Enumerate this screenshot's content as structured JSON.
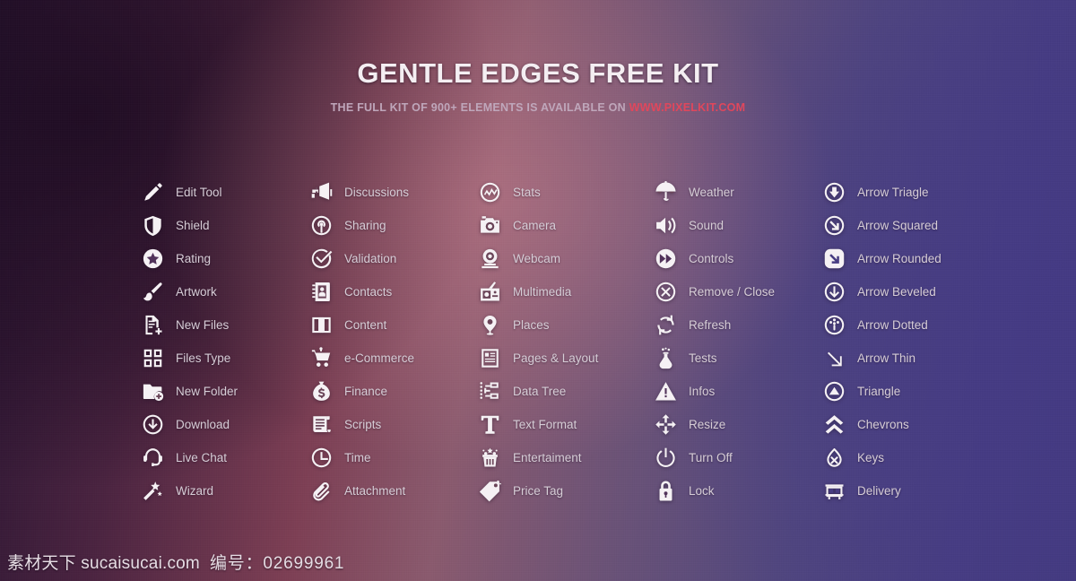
{
  "header": {
    "title": "GENTLE EDGES FREE KIT",
    "subtitle_prefix": "THE FULL KIT OF 900+ ELEMENTS IS AVAILABLE ON ",
    "subtitle_url": "WWW.PIXELKIT.COM"
  },
  "colors": {
    "title": "#f4eef2",
    "subtitle": "#bfa7bb",
    "url_accent": "#e0475c",
    "icon": "#f5f1f4",
    "label": "#d6cdd6",
    "bg_left": "#281431",
    "bg_mid": "#8a5a6e",
    "bg_right": "#473d82"
  },
  "columns": [
    {
      "name": "column-1",
      "items": [
        {
          "label": "Edit Tool",
          "icon": "pencil-icon"
        },
        {
          "label": "Shield",
          "icon": "shield-icon"
        },
        {
          "label": "Rating",
          "icon": "star-circle-icon"
        },
        {
          "label": "Artwork",
          "icon": "paintbrush-icon"
        },
        {
          "label": "New Files",
          "icon": "new-file-icon"
        },
        {
          "label": "Files Type",
          "icon": "grid-squares-icon"
        },
        {
          "label": "New Folder",
          "icon": "new-folder-icon"
        },
        {
          "label": "Download",
          "icon": "download-circle-icon"
        },
        {
          "label": "Live Chat",
          "icon": "headset-icon"
        },
        {
          "label": "Wizard",
          "icon": "magic-wand-icon"
        }
      ]
    },
    {
      "name": "column-2",
      "items": [
        {
          "label": "Discussions",
          "icon": "megaphone-icon"
        },
        {
          "label": "Sharing",
          "icon": "broadcast-circle-icon"
        },
        {
          "label": "Validation",
          "icon": "check-circle-icon"
        },
        {
          "label": "Contacts",
          "icon": "address-book-icon"
        },
        {
          "label": "Content",
          "icon": "open-book-icon"
        },
        {
          "label": "e-Commerce",
          "icon": "shopping-cart-icon"
        },
        {
          "label": "Finance",
          "icon": "money-bag-icon"
        },
        {
          "label": "Scripts",
          "icon": "scroll-document-icon"
        },
        {
          "label": "Time",
          "icon": "clock-icon"
        },
        {
          "label": "Attachment",
          "icon": "paperclip-icon"
        }
      ]
    },
    {
      "name": "column-3",
      "items": [
        {
          "label": "Stats",
          "icon": "stats-circle-icon"
        },
        {
          "label": "Camera",
          "icon": "camera-icon"
        },
        {
          "label": "Webcam",
          "icon": "webcam-icon"
        },
        {
          "label": "Multimedia",
          "icon": "radio-icon"
        },
        {
          "label": "Places",
          "icon": "map-pin-icon"
        },
        {
          "label": "Pages & Layout",
          "icon": "page-layout-icon"
        },
        {
          "label": "Data Tree",
          "icon": "data-tree-icon"
        },
        {
          "label": "Text Format",
          "icon": "text-format-icon"
        },
        {
          "label": "Entertaiment",
          "icon": "popcorn-icon"
        },
        {
          "label": "Price Tag",
          "icon": "price-tag-icon"
        }
      ]
    },
    {
      "name": "column-4",
      "items": [
        {
          "label": "Weather",
          "icon": "umbrella-icon"
        },
        {
          "label": "Sound",
          "icon": "speaker-icon"
        },
        {
          "label": "Controls",
          "icon": "fast-forward-circle-icon"
        },
        {
          "label": "Remove / Close",
          "icon": "close-circle-icon"
        },
        {
          "label": "Refresh",
          "icon": "refresh-icon"
        },
        {
          "label": "Tests",
          "icon": "flask-icon"
        },
        {
          "label": "Infos",
          "icon": "warning-triangle-icon"
        },
        {
          "label": "Resize",
          "icon": "move-arrows-icon"
        },
        {
          "label": "Turn Off",
          "icon": "power-icon"
        },
        {
          "label": "Lock",
          "icon": "lock-icon"
        }
      ]
    },
    {
      "name": "column-5",
      "items": [
        {
          "label": "Arrow Triagle",
          "icon": "arrow-down-circle-icon"
        },
        {
          "label": "Arrow Squared",
          "icon": "arrow-diagonal-circle-icon"
        },
        {
          "label": "Arrow Rounded",
          "icon": "arrow-diagonal-filled-icon"
        },
        {
          "label": "Arrow Beveled",
          "icon": "arrow-down-beveled-icon"
        },
        {
          "label": "Arrow Dotted",
          "icon": "arrow-dotted-circle-icon"
        },
        {
          "label": "Arrow Thin",
          "icon": "arrow-thin-icon"
        },
        {
          "label": "Triangle",
          "icon": "triangle-up-circle-icon"
        },
        {
          "label": "Chevrons",
          "icon": "chevrons-up-icon"
        },
        {
          "label": "Keys",
          "icon": "key-drop-icon"
        },
        {
          "label": "Delivery",
          "icon": "delivery-truck-icon"
        }
      ]
    }
  ],
  "watermark": {
    "site": "素材天下 sucaisucai.com",
    "id": "编号：02699961"
  }
}
